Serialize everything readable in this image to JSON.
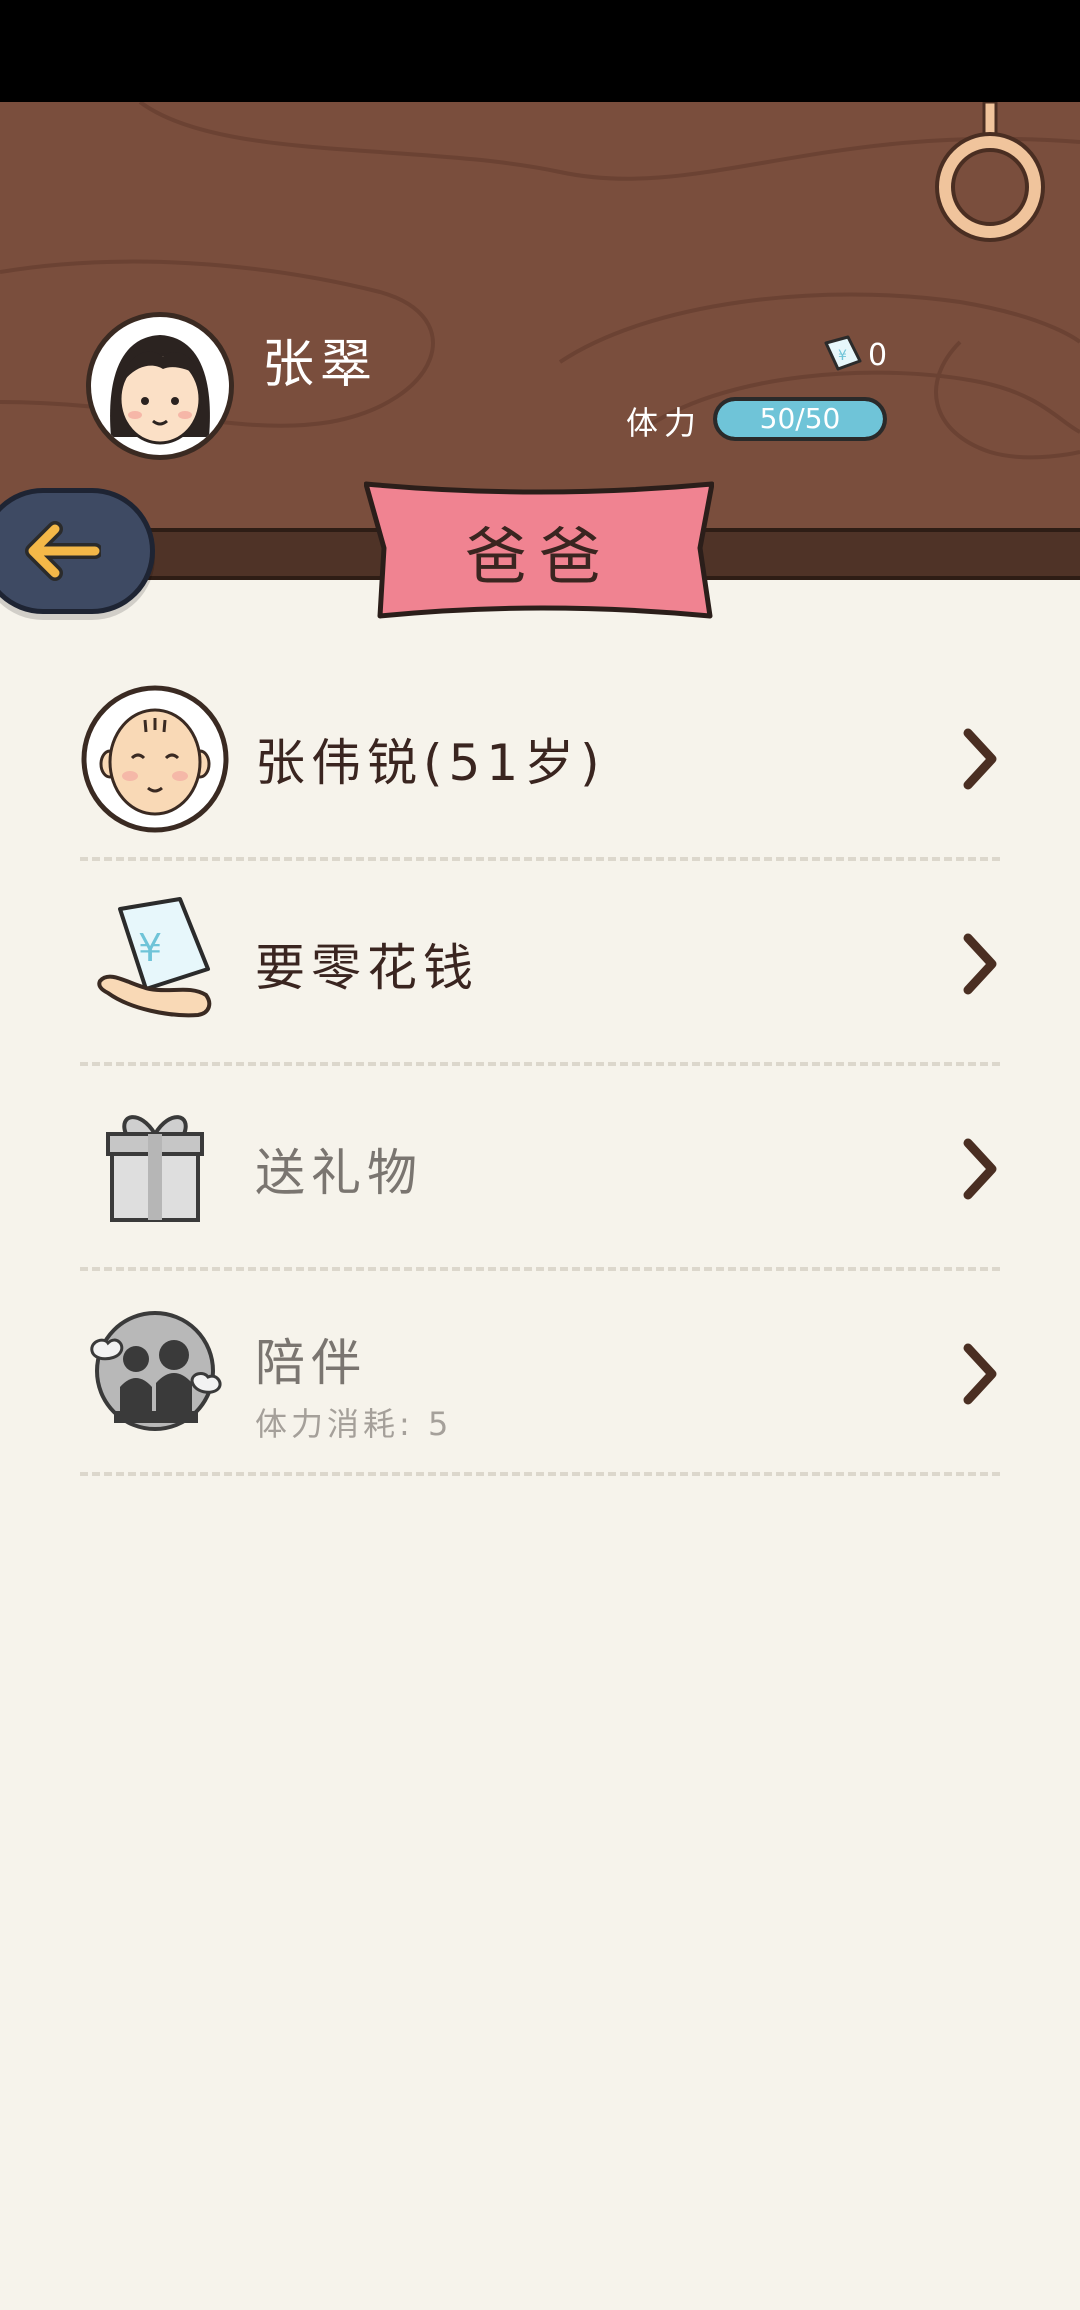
{
  "player": {
    "name": "张翠",
    "money_count": "0",
    "stamina_label": "体力",
    "stamina_text": "50/50",
    "stamina_fraction": 1.0
  },
  "header": {
    "title": "爸爸"
  },
  "menu": {
    "items": [
      {
        "label": "张伟锐(51岁)",
        "icon": "father-avatar-icon"
      },
      {
        "label": "要零花钱",
        "icon": "money-hand-icon"
      },
      {
        "label": "送礼物",
        "icon": "gift-icon"
      },
      {
        "label": "陪伴",
        "sublabel": "体力消耗: 5",
        "icon": "accompany-icon"
      }
    ]
  },
  "colors": {
    "wood": "#7a4e3d",
    "ribbon": "#f08391",
    "stamina": "#6fc4d8",
    "back_button": "#3e4a63",
    "arrow": "#f4b848",
    "background": "#f6f3eb"
  },
  "icons": {
    "ring": "ring-hook-icon",
    "money": "money-bill-icon",
    "back": "back-arrow-icon",
    "chevron": "chevron-right-icon"
  }
}
